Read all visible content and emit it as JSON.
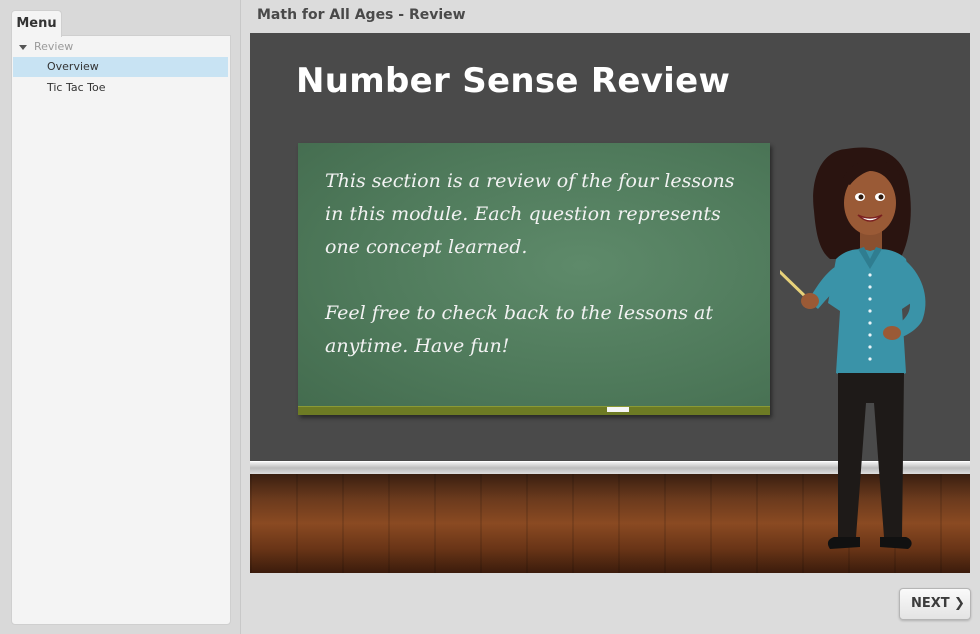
{
  "sidebar": {
    "menu_tab": "Menu",
    "section": "Review",
    "items": [
      {
        "label": "Overview",
        "selected": true
      },
      {
        "label": "Tic Tac Toe",
        "selected": false
      }
    ]
  },
  "header": {
    "title": "Math for All Ages - Review"
  },
  "slide": {
    "title": "Number Sense Review",
    "board_paragraph_1": "This section is a review of the four lessons in this module. Each question represents one concept learned.",
    "board_paragraph_2": "Feel free to check back to the lessons at anytime. Have fun!"
  },
  "nav": {
    "next_label": "NEXT",
    "next_icon": "chevron-right-icon"
  },
  "colors": {
    "selected_item": "#c8e3f3",
    "slide_background": "#4a4a4a",
    "chalkboard": "#4f7a5b",
    "teacher_shirt": "#3a93a8"
  }
}
